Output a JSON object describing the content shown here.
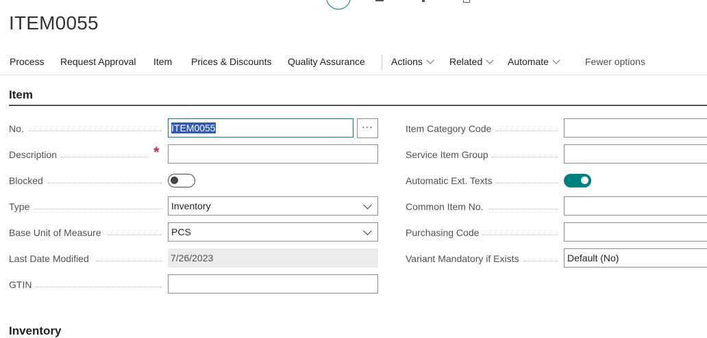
{
  "page_title": "ITEM0055",
  "actions": {
    "process": "Process",
    "request_approval": "Request Approval",
    "item": "Item",
    "prices_discounts": "Prices & Discounts",
    "quality_assurance": "Quality Assurance",
    "actions": "Actions",
    "related": "Related",
    "automate": "Automate",
    "fewer_options": "Fewer options"
  },
  "section": {
    "title": "Item",
    "next_title": "Inventory"
  },
  "left_fields": {
    "no": {
      "label": "No.",
      "value": "ITEM0055"
    },
    "description": {
      "label": "Description",
      "value": "",
      "required_mark": "*"
    },
    "blocked": {
      "label": "Blocked",
      "on": false
    },
    "type": {
      "label": "Type",
      "value": "Inventory"
    },
    "base_uom": {
      "label": "Base Unit of Measure",
      "value": "PCS"
    },
    "last_modified": {
      "label": "Last Date Modified",
      "value": "7/26/2023"
    },
    "gtin": {
      "label": "GTIN",
      "value": ""
    }
  },
  "right_fields": {
    "item_category": {
      "label": "Item Category Code",
      "value": ""
    },
    "service_item_group": {
      "label": "Service Item Group",
      "value": ""
    },
    "auto_ext_texts": {
      "label": "Automatic Ext. Texts",
      "on": true
    },
    "common_item_no": {
      "label": "Common Item No.",
      "value": ""
    },
    "purchasing_code": {
      "label": "Purchasing Code",
      "value": ""
    },
    "variant_mandatory": {
      "label": "Variant Mandatory if Exists",
      "value": "Default (No)"
    }
  },
  "lookup_button": "···",
  "colors": {
    "accent": "#00807f",
    "required": "#c4314b",
    "selection": "#2e59b6"
  }
}
